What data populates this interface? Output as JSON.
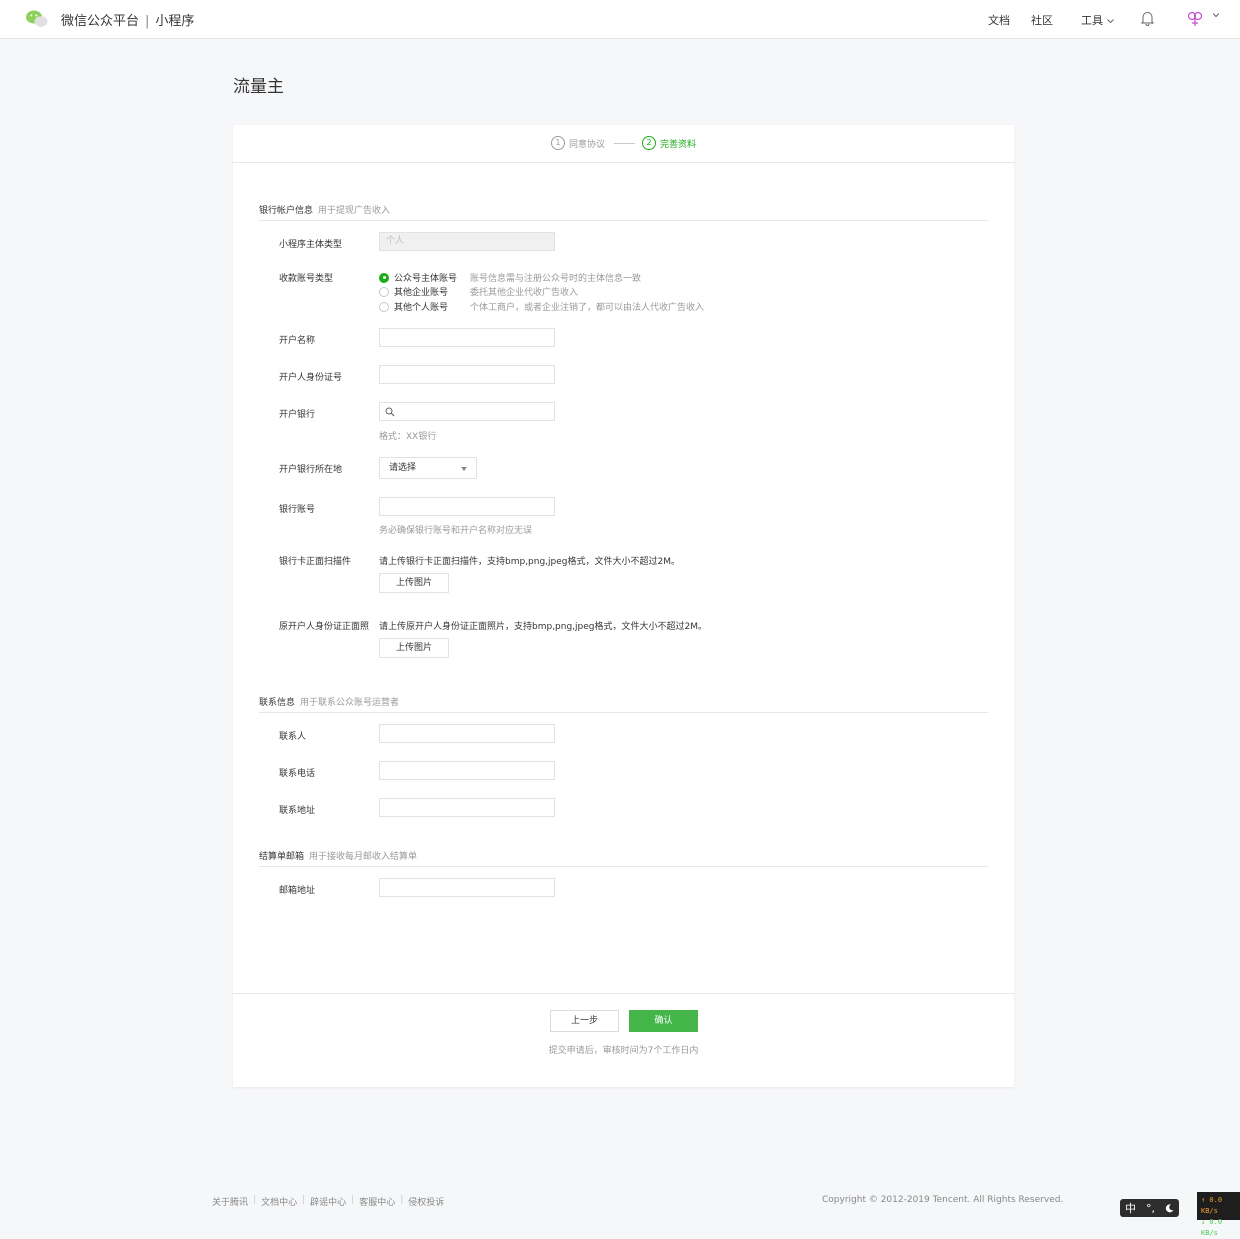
{
  "header": {
    "brand": "微信公众平台",
    "separator": "|",
    "product": "小程序",
    "nav": {
      "docs": "文档",
      "community": "社区",
      "tools": "工具"
    }
  },
  "page_title": "流量主",
  "steps": [
    {
      "num": "1",
      "label": "同意协议"
    },
    {
      "num": "2",
      "label": "完善资料"
    }
  ],
  "bank_section": {
    "title": "银行帐户信息",
    "desc": "用于提现广告收入",
    "entity_type_label": "小程序主体类型",
    "entity_type_value": "个人",
    "account_type_label": "收款账号类型",
    "account_options": [
      {
        "label": "公众号主体账号",
        "desc": "账号信息需与注册公众号时的主体信息一致"
      },
      {
        "label": "其他企业账号",
        "desc": "委托其他企业代收广告收入"
      },
      {
        "label": "其他个人账号",
        "desc": "个体工商户，或者企业注销了，都可以由法人代收广告收入"
      }
    ],
    "account_name_label": "开户名称",
    "id_number_label": "开户人身份证号",
    "bank_label": "开户银行",
    "bank_hint": "格式：XX银行",
    "bank_location_label": "开户银行所在地",
    "bank_location_select": "请选择",
    "account_number_label": "银行账号",
    "account_number_hint": "务必确保银行账号和开户名称对应无误",
    "card_scan_label": "银行卡正面扫描件",
    "card_scan_note": "请上传银行卡正面扫描件，支持bmp,png,jpeg格式，文件大小不超过2M。",
    "upload_label": "上传图片",
    "id_photo_label": "原开户人身份证正面照",
    "id_photo_note": "请上传原开户人身份证正面照片，支持bmp,png,jpeg格式，文件大小不超过2M。"
  },
  "contact_section": {
    "title": "联系信息",
    "desc": "用于联系公众账号运营者",
    "contact_label": "联系人",
    "phone_label": "联系电话",
    "address_label": "联系地址"
  },
  "email_section": {
    "title": "结算单邮箱",
    "desc": "用于接收每月邮收入结算单",
    "email_label": "邮箱地址"
  },
  "actions": {
    "prev": "上一步",
    "confirm": "确认",
    "note": "提交申请后，审核时间为7个工作日内"
  },
  "footer": {
    "links": [
      "关于腾讯",
      "文档中心",
      "辟谣中心",
      "客服中心",
      "侵权投诉"
    ],
    "copyright": "Copyright © 2012-2019 Tencent. All Rights Reserved."
  },
  "tray": {
    "ime": "中",
    "ime_extra": "°,",
    "net_up": "↑ 0.0 KB/s",
    "net_down": "↓ 0.0 KB/s"
  },
  "colors": {
    "accent": "#1aad19",
    "button": "#44b549"
  }
}
